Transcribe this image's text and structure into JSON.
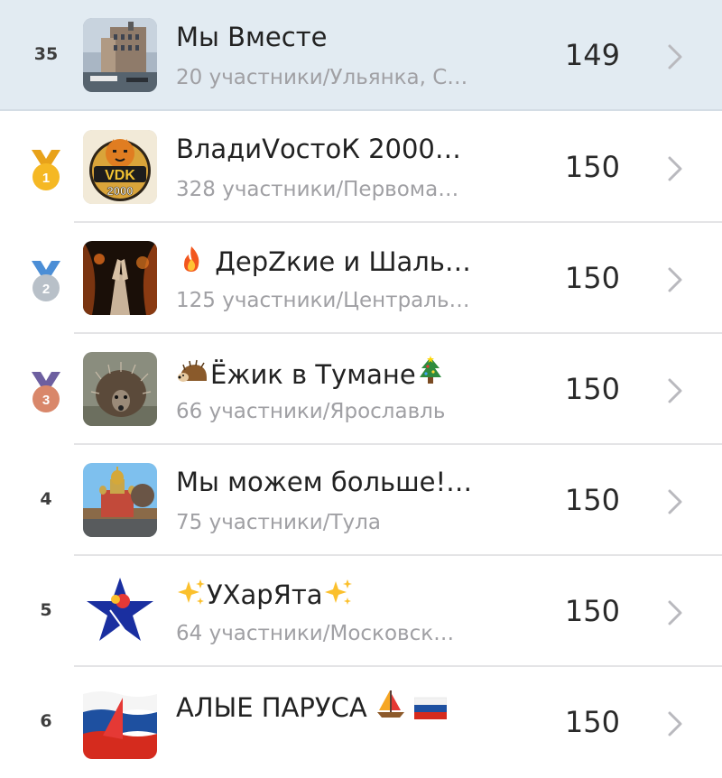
{
  "rows": [
    {
      "rank": "35",
      "title": "Мы Вместе",
      "subtitle": "20 участники/Ульянка, С…",
      "score": "149",
      "highlight": true
    },
    {
      "rank": "1",
      "medal": "gold",
      "title": "ВладиVостоК 2000…",
      "subtitle": "328 участники/Первома…",
      "score": "150"
    },
    {
      "rank": "2",
      "medal": "silver",
      "title": "ДерZкие и Шаль…",
      "title_icon": "fire-emoji-icon",
      "subtitle": "125 участники/Централь…",
      "score": "150"
    },
    {
      "rank": "3",
      "medal": "bronze",
      "title": "Ёжик в Тумане",
      "title_icon": "hedgehog-emoji-icon",
      "title_icon_end": "christmas-tree-emoji-icon",
      "subtitle": "66 участники/Ярославль",
      "score": "150"
    },
    {
      "rank": "4",
      "title": "Мы можем больше!…",
      "subtitle": "75 участники/Тула",
      "score": "150"
    },
    {
      "rank": "5",
      "title": "УХарЯта",
      "title_icon": "sparkles-emoji-icon",
      "title_icon_end": "sparkles-emoji-icon",
      "subtitle": "64 участники/Московск…",
      "score": "150"
    },
    {
      "rank": "6",
      "title": "АЛЫЕ ПАРУСА",
      "title_icon_end": "sailboat-emoji-icon",
      "title_icon_end2": "russia-flag-emoji-icon",
      "subtitle": "",
      "score": "150"
    }
  ],
  "avatars": {
    "0": "saint-petersburg-building-avatar",
    "1": "tiger-vdk-2000-logo-avatar",
    "2": "dark-fire-hands-avatar",
    "3": "hedgehog-avatar",
    "4": "tula-cathedral-avatar",
    "5": "blue-star-logo-avatar",
    "6": "red-sail-flag-avatar"
  },
  "medal_colors": {
    "gold": "#f5b824",
    "silver": "#b8c0c8",
    "bronze": "#d9876a",
    "gold_ribbon": "#e8a21a",
    "silver_ribbon": "#4b8ed6",
    "bronze_ribbon": "#6d5fa0"
  },
  "colors": {
    "highlight_bg": "#e2ebf2",
    "title": "#222222",
    "subtitle": "#a0a0a4",
    "chevron": "#b9b9be"
  }
}
